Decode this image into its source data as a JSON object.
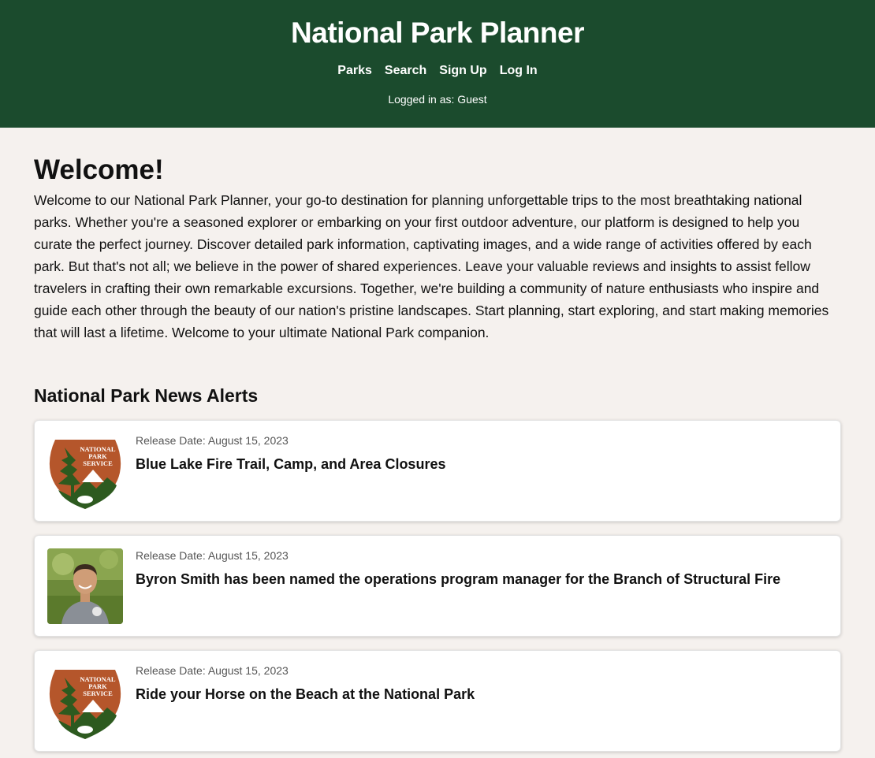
{
  "header": {
    "title": "National Park Planner",
    "nav": [
      "Parks",
      "Search",
      "Sign Up",
      "Log In"
    ],
    "status": "Logged in as: Guest"
  },
  "main": {
    "welcome_title": "Welcome!",
    "welcome_text": "Welcome to our National Park Planner, your go-to destination for planning unforgettable trips to the most breathtaking national parks. Whether you're a seasoned explorer or embarking on your first outdoor adventure, our platform is designed to help you curate the perfect journey. Discover detailed park information, captivating images, and a wide range of activities offered by each park. But that's not all; we believe in the power of shared experiences. Leave your valuable reviews and insights to assist fellow travelers in crafting their own remarkable excursions. Together, we're building a community of nature enthusiasts who inspire and guide each other through the beauty of our nation's pristine landscapes. Start planning, start exploring, and start making memories that will last a lifetime. Welcome to your ultimate National Park companion.",
    "news_heading": "National Park News Alerts",
    "news": [
      {
        "date": "Release Date: August 15, 2023",
        "title": "Blue Lake Fire Trail, Camp, and Area Closures",
        "image": "nps-arrowhead-logo",
        "logo_text": [
          "NATIONAL",
          "PARK",
          "SERVICE"
        ]
      },
      {
        "date": "Release Date: August 15, 2023",
        "title": "Byron Smith has been named the operations program manager for the Branch of Structural Fire",
        "image": "person-photo"
      },
      {
        "date": "Release Date: August 15, 2023",
        "title": "Ride your Horse on the Beach at the National Park",
        "image": "nps-arrowhead-logo",
        "logo_text": [
          "NATIONAL",
          "PARK",
          "SERVICE"
        ]
      }
    ]
  },
  "colors": {
    "header_bg": "#1b4b2d",
    "page_bg": "#f5f1ee",
    "card_bg": "#ffffff",
    "nps_brown": "#b5562b",
    "nps_green": "#2d5a1f"
  }
}
